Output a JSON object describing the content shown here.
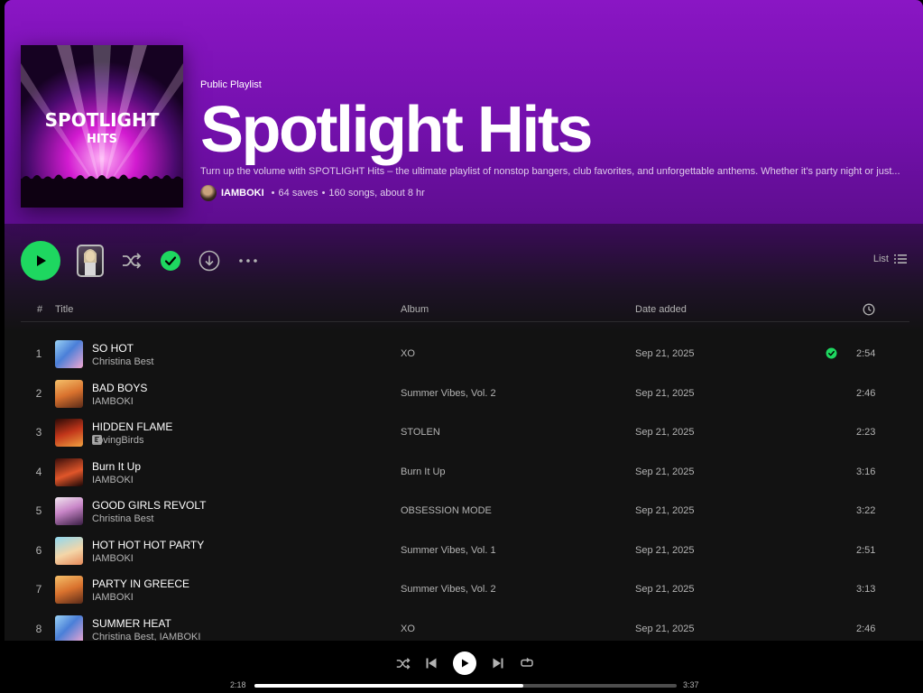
{
  "playlist": {
    "type_label": "Public Playlist",
    "title": "Spotlight Hits",
    "description": "Turn up the volume with SPOTLIGHT Hits – the ultimate playlist of nonstop bangers, club favorites, and unforgettable anthems. Whether it's party night or just...",
    "owner": "IAMBOKI",
    "saves": "64 saves",
    "summary": "160 songs, about 8 hr",
    "cover_text_line1": "SPOTLIGHT",
    "cover_text_line2": "HITS"
  },
  "actions": {
    "view_label": "List",
    "icons": [
      "play-icon",
      "shuffle-icon",
      "saved-check-icon",
      "download-icon",
      "more-icon",
      "list-icon"
    ]
  },
  "table": {
    "headers": {
      "num": "#",
      "title": "Title",
      "album": "Album",
      "date": "Date added"
    },
    "rows": [
      {
        "num": "1",
        "title": "SO HOT",
        "artist": "Christina Best",
        "explicit": false,
        "album": "XO",
        "date": "Sep 21, 2025",
        "duration": "2:54",
        "saved": true
      },
      {
        "num": "2",
        "title": "BAD BOYS",
        "artist": "IAMBOKI",
        "explicit": false,
        "album": "Summer Vibes, Vol. 2",
        "date": "Sep 21, 2025",
        "duration": "2:46",
        "saved": false
      },
      {
        "num": "3",
        "title": "HIDDEN FLAME",
        "artist": "LovingBirds",
        "explicit": true,
        "album": "STOLEN",
        "date": "Sep 21, 2025",
        "duration": "2:23",
        "saved": false
      },
      {
        "num": "4",
        "title": "Burn It Up",
        "artist": "IAMBOKI",
        "explicit": false,
        "album": "Burn It Up",
        "date": "Sep 21, 2025",
        "duration": "3:16",
        "saved": false
      },
      {
        "num": "5",
        "title": "GOOD GIRLS REVOLT",
        "artist": "Christina Best",
        "explicit": false,
        "album": "OBSESSION MODE",
        "date": "Sep 21, 2025",
        "duration": "3:22",
        "saved": false
      },
      {
        "num": "6",
        "title": "HOT HOT HOT PARTY",
        "artist": "IAMBOKI",
        "explicit": false,
        "album": "Summer Vibes, Vol. 1",
        "date": "Sep 21, 2025",
        "duration": "2:51",
        "saved": false
      },
      {
        "num": "7",
        "title": "PARTY IN GREECE",
        "artist": "IAMBOKI",
        "explicit": false,
        "album": "Summer Vibes, Vol. 2",
        "date": "Sep 21, 2025",
        "duration": "3:13",
        "saved": false
      },
      {
        "num": "8",
        "title": "SUMMER HEAT",
        "artist": "Christina Best, IAMBOKI",
        "explicit": false,
        "album": "XO",
        "date": "Sep 21, 2025",
        "duration": "2:46",
        "saved": false
      }
    ]
  },
  "player": {
    "elapsed": "2:18",
    "total": "3:37",
    "progress_fraction": 0.636
  },
  "colors": {
    "accent": "#1ed760",
    "hero": "#8a16c4",
    "background": "#121212"
  }
}
